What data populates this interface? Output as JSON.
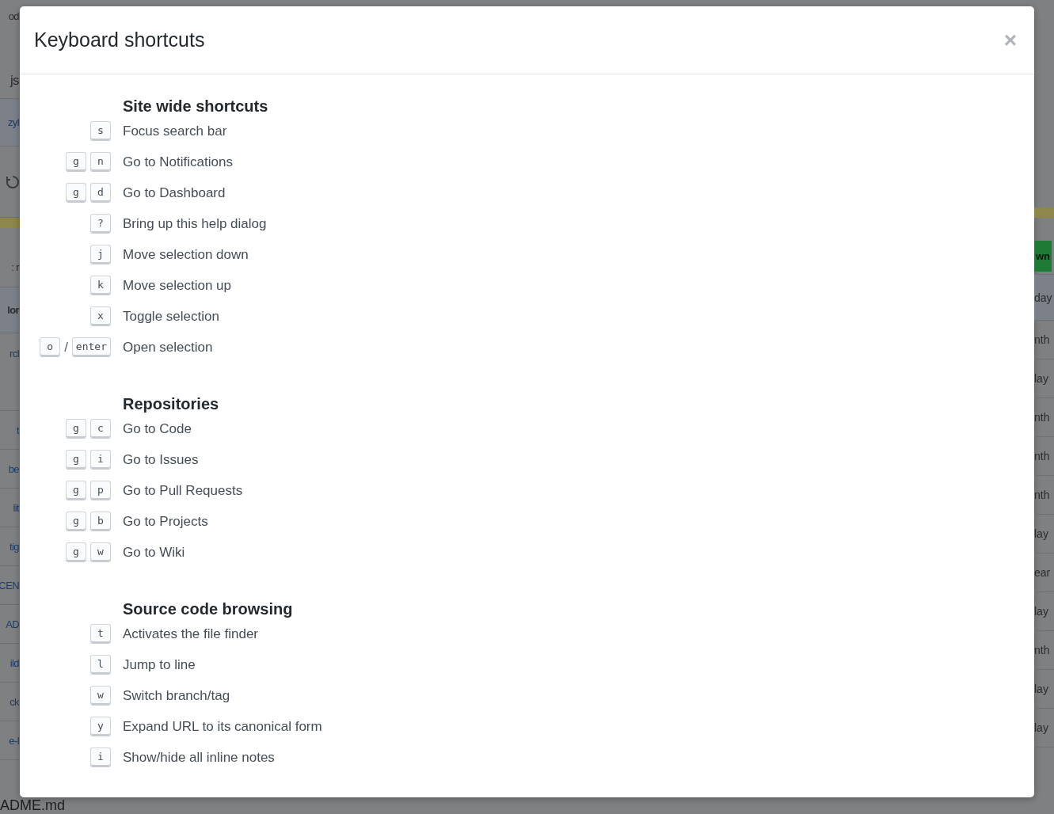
{
  "dialog": {
    "title": "Keyboard shortcuts",
    "close": "×",
    "sections": [
      {
        "heading": "Site wide shortcuts",
        "shortcuts": [
          {
            "keys": [
              "s"
            ],
            "description": "Focus search bar"
          },
          {
            "keys": [
              "g",
              "n"
            ],
            "description": "Go to Notifications"
          },
          {
            "keys": [
              "g",
              "d"
            ],
            "description": "Go to Dashboard"
          },
          {
            "keys": [
              "?"
            ],
            "description": "Bring up this help dialog"
          },
          {
            "keys": [
              "j"
            ],
            "description": "Move selection down"
          },
          {
            "keys": [
              "k"
            ],
            "description": "Move selection up"
          },
          {
            "keys": [
              "x"
            ],
            "description": "Toggle selection"
          },
          {
            "keys": [
              "o",
              "enter"
            ],
            "separator": "/",
            "description": "Open selection"
          }
        ]
      },
      {
        "heading": "Repositories",
        "shortcuts": [
          {
            "keys": [
              "g",
              "c"
            ],
            "description": "Go to Code"
          },
          {
            "keys": [
              "g",
              "i"
            ],
            "description": "Go to Issues"
          },
          {
            "keys": [
              "g",
              "p"
            ],
            "description": "Go to Pull Requests"
          },
          {
            "keys": [
              "g",
              "b"
            ],
            "description": "Go to Projects"
          },
          {
            "keys": [
              "g",
              "w"
            ],
            "description": "Go to Wiki"
          }
        ]
      },
      {
        "heading": "Source code browsing",
        "shortcuts": [
          {
            "keys": [
              "t"
            ],
            "description": "Activates the file finder"
          },
          {
            "keys": [
              "l"
            ],
            "description": "Jump to line"
          },
          {
            "keys": [
              "w"
            ],
            "description": "Switch branch/tag"
          },
          {
            "keys": [
              "y"
            ],
            "description": "Expand URL to its canonical form"
          },
          {
            "keys": [
              "i"
            ],
            "description": "Show/hide all inline notes"
          }
        ]
      }
    ]
  },
  "background": {
    "left": [
      {
        "kind": "text",
        "text": "od"
      },
      {
        "kind": "title",
        "text": "js"
      },
      {
        "kind": "link",
        "text": "zyl"
      },
      {
        "kind": "icon"
      },
      {
        "kind": "bar"
      },
      {
        "kind": "text",
        "text": ": r"
      },
      {
        "kind": "bold",
        "text": "lor"
      },
      {
        "kind": "link",
        "text": "rcl"
      },
      {
        "kind": "link",
        "text": "t"
      },
      {
        "kind": "link",
        "text": "be"
      },
      {
        "kind": "link",
        "text": "lit"
      },
      {
        "kind": "link",
        "text": "tig"
      },
      {
        "kind": "link",
        "text": "CEN"
      },
      {
        "kind": "link",
        "text": "AD"
      },
      {
        "kind": "link",
        "text": "ild"
      },
      {
        "kind": "link",
        "text": "ck"
      },
      {
        "kind": "link",
        "text": "e-l"
      }
    ],
    "right": [
      {
        "kind": "bar"
      },
      {
        "kind": "button",
        "text": "wn"
      },
      {
        "kind": "text",
        "text": "day"
      },
      {
        "kind": "text",
        "text": "nth"
      },
      {
        "kind": "text",
        "text": "lay"
      },
      {
        "kind": "text",
        "text": "nth"
      },
      {
        "kind": "text",
        "text": "nth"
      },
      {
        "kind": "text",
        "text": "nth"
      },
      {
        "kind": "text",
        "text": "lay"
      },
      {
        "kind": "text",
        "text": "ear"
      },
      {
        "kind": "text",
        "text": "lay"
      },
      {
        "kind": "text",
        "text": "nth"
      },
      {
        "kind": "text",
        "text": "lay"
      },
      {
        "kind": "text",
        "text": "lay"
      }
    ],
    "footer": "ADME.md"
  }
}
